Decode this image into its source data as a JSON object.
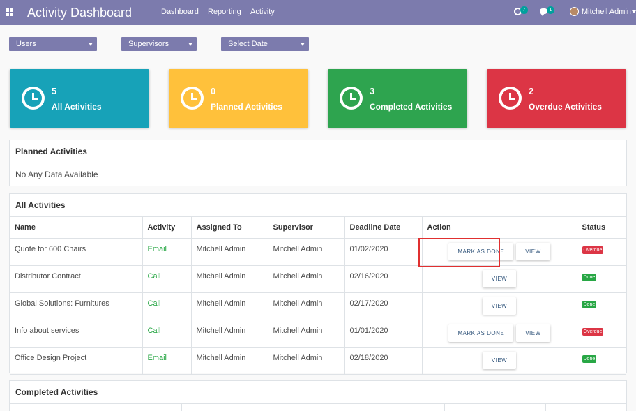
{
  "navbar": {
    "title": "Activity Dashboard",
    "menu": [
      "Dashboard",
      "Reporting",
      "Activity"
    ],
    "activity_badge": "7",
    "message_badge": "1",
    "user": "Mitchell Admin"
  },
  "filters": [
    "Users",
    "Supervisors",
    "Select Date"
  ],
  "cards": [
    {
      "count": "5",
      "label": "All Activities",
      "color": "#17a2b8"
    },
    {
      "count": "0",
      "label": "Planned Activities",
      "color": "#ffc13b"
    },
    {
      "count": "3",
      "label": "Completed Activities",
      "color": "#2ea44f"
    },
    {
      "count": "2",
      "label": "Overdue Activities",
      "color": "#dc3545"
    }
  ],
  "planned": {
    "title": "Planned Activities",
    "empty": "No Any Data Available"
  },
  "all": {
    "title": "All Activities",
    "columns": [
      "Name",
      "Activity",
      "Assigned To",
      "Supervisor",
      "Deadline Date",
      "Action",
      "Status"
    ],
    "mark_done_label": "MARK AS DONE",
    "view_label": "VIEW",
    "rows": [
      {
        "name": "Quote for 600 Chairs",
        "activity": "Email",
        "assigned": "Mitchell Admin",
        "supervisor": "Mitchell Admin",
        "deadline": "01/02/2020",
        "status": "Overdue"
      },
      {
        "name": "Distributor Contract",
        "activity": "Call",
        "assigned": "Mitchell Admin",
        "supervisor": "Mitchell Admin",
        "deadline": "02/16/2020",
        "status": "Done"
      },
      {
        "name": "Global Solutions: Furnitures",
        "activity": "Call",
        "assigned": "Mitchell Admin",
        "supervisor": "Mitchell Admin",
        "deadline": "02/17/2020",
        "status": "Done"
      },
      {
        "name": "Info about services",
        "activity": "Call",
        "assigned": "Mitchell Admin",
        "supervisor": "Mitchell Admin",
        "deadline": "01/01/2020",
        "status": "Overdue"
      },
      {
        "name": "Office Design Project",
        "activity": "Email",
        "assigned": "Mitchell Admin",
        "supervisor": "Mitchell Admin",
        "deadline": "02/18/2020",
        "status": "Done"
      }
    ]
  },
  "completed": {
    "title": "Completed Activities"
  }
}
